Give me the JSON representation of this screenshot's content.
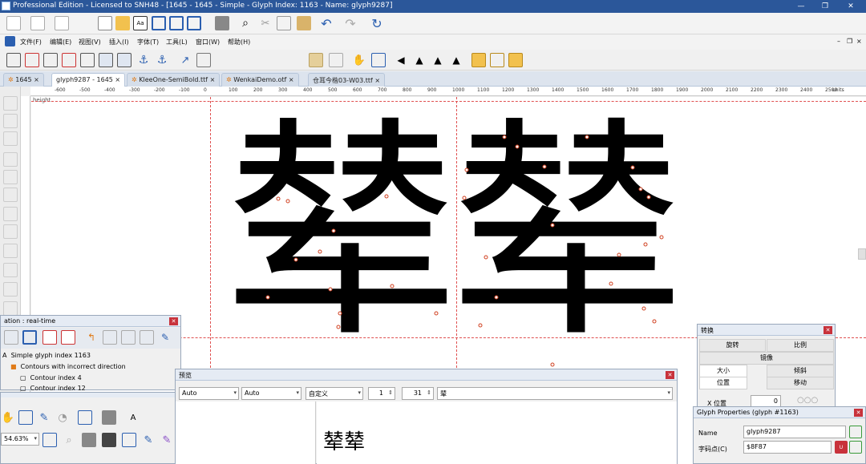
{
  "window": {
    "title": "Professional Edition - Licensed to SNH48 - [1645 - 1645 - Simple - Glyph Index: 1163 - Name: glyph9287]",
    "minimize": "—",
    "restore": "❐",
    "close": "✕"
  },
  "menu": {
    "items": [
      "文件(F)",
      "编辑(E)",
      "视图(V)",
      "插入(I)",
      "字体(T)",
      "工具(L)",
      "窗口(W)",
      "帮助(H)"
    ],
    "mdi_controls": [
      "–",
      "❐",
      "×"
    ]
  },
  "tabs": [
    {
      "label": "1645",
      "icon": "gear-icon"
    },
    {
      "label": "glyph9287 - 1645",
      "icon": "",
      "active": true
    },
    {
      "label": "KleeOne-SemiBold.ttf",
      "icon": "gear-icon"
    },
    {
      "label": "WenkaiDemo.otf",
      "icon": "gear-icon"
    },
    {
      "label": "仓耳今楷03-W03.ttf",
      "icon": ""
    }
  ],
  "ruler": {
    "ticks": [
      "-600",
      "-500",
      "-400",
      "-300",
      "-200",
      "-100",
      "0",
      "100",
      "200",
      "300",
      "400",
      "500",
      "600",
      "700",
      "800",
      "900",
      "1000",
      "1100",
      "1200",
      "1300",
      "1400",
      "1500",
      "1600",
      "1700",
      "1800",
      "1900",
      "2000",
      "2100",
      "2200",
      "2300",
      "2400",
      "2500"
    ],
    "units": "units",
    "height_label": "height"
  },
  "canvas": {
    "glyph_char": "辇"
  },
  "validation_panel": {
    "title": "ation : real-time",
    "items": [
      {
        "label": "Simple glyph index 1163",
        "level": 0
      },
      {
        "label": "Contours with incorrect direction",
        "level": 1
      },
      {
        "label": "Contour index 4",
        "level": 2
      },
      {
        "label": "Contour index 12",
        "level": 2
      }
    ]
  },
  "tools_panel": {
    "zoom": "54.63%"
  },
  "preview_panel": {
    "title": "预览",
    "combo1": "Auto",
    "combo2": "Auto",
    "combo3": "自定义",
    "spin1": "1",
    "spin2": "31",
    "text_field": "辇",
    "preview_text": "辇辇"
  },
  "transform_panel": {
    "title": "转换",
    "rotate": "旋转",
    "scale": "比例",
    "mirror": "镜像",
    "size": "大小",
    "skew": "倾斜",
    "position": "位置",
    "move": "移动",
    "x_pos_label": "X 位置",
    "x_pos_value": "0"
  },
  "glyph_props": {
    "title": "Glyph Properties (glyph #1163)",
    "name_label": "Name",
    "name_value": "glyph9287",
    "codepoint_label": "字码点(C)",
    "codepoint_value": "$8F87"
  },
  "colors": {
    "accent": "#2b579a",
    "guide": "#e05050"
  }
}
